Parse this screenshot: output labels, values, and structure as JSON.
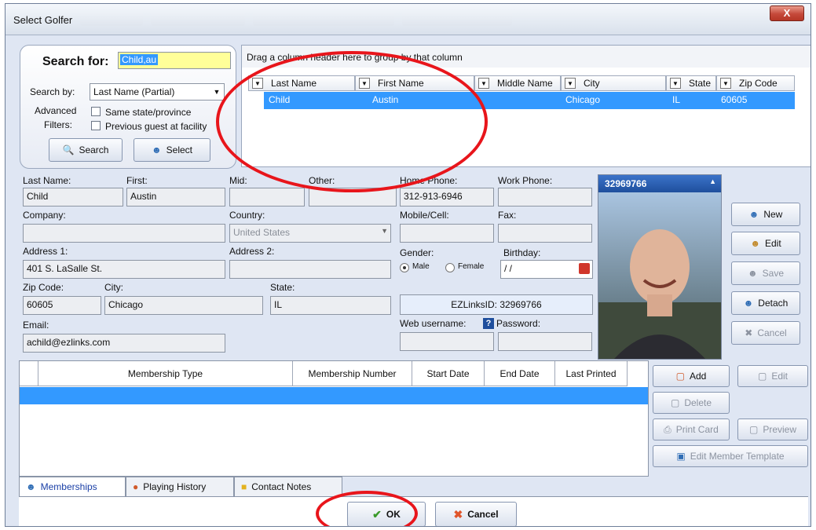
{
  "window": {
    "title": "Select Golfer",
    "close_label": "X"
  },
  "search": {
    "heading": "Search for:",
    "query": "Child,au",
    "search_by_label": "Search by:",
    "search_by_value": "Last Name (Partial)",
    "advanced_label": "Advanced",
    "filters_label": "Filters:",
    "same_state_label": "Same state/province",
    "previous_guest_label": "Previous guest at facility",
    "search_button": "Search",
    "select_button": "Select"
  },
  "grid": {
    "group_hint": "Drag a column header here to group by that column",
    "columns": [
      "Last Name",
      "First Name",
      "Middle Name",
      "City",
      "State",
      "Zip Code"
    ],
    "rows": [
      {
        "last": "Child",
        "first": "Austin",
        "middle": "",
        "city": "Chicago",
        "state": "IL",
        "zip": "60605"
      }
    ]
  },
  "form": {
    "last_name_label": "Last Name:",
    "last_name": "Child",
    "first_label": "First:",
    "first": "Austin",
    "mid_label": "Mid:",
    "mid": "",
    "other_label": "Other:",
    "other": "",
    "home_phone_label": "Home Phone:",
    "home_phone": "312-913-6946",
    "work_phone_label": "Work Phone:",
    "work_phone": "",
    "company_label": "Company:",
    "company": "",
    "country_label": "Country:",
    "country": "United States",
    "mobile_label": "Mobile/Cell:",
    "mobile": "",
    "fax_label": "Fax:",
    "fax": "",
    "address1_label": "Address 1:",
    "address1": "401 S. LaSalle St.",
    "address2_label": "Address 2:",
    "address2": "",
    "gender_label": "Gender:",
    "male_label": "Male",
    "female_label": "Female",
    "birthday_label": "Birthday:",
    "birthday": "/ /",
    "zip_label": "Zip Code:",
    "zip": "60605",
    "city_label": "City:",
    "city": "Chicago",
    "state_label": "State:",
    "state": "IL",
    "ezlinks_label": "EZLinksID:",
    "ezlinks_id": "32969766",
    "email_label": "Email:",
    "email": "achild@ezlinks.com",
    "web_username_label": "Web username:",
    "web_username": "",
    "password_label": "Password:",
    "password": "",
    "help_icon_text": "?"
  },
  "photo": {
    "id": "32969766"
  },
  "side_buttons": {
    "new": "New",
    "edit": "Edit",
    "save": "Save",
    "detach": "Detach",
    "cancel": "Cancel"
  },
  "membership": {
    "columns": [
      "Membership Type",
      "Membership Number",
      "Start Date",
      "End Date",
      "Last Printed"
    ],
    "buttons": {
      "add": "Add",
      "edit": "Edit",
      "delete": "Delete",
      "print_card": "Print Card",
      "preview": "Preview",
      "edit_template": "Edit Member Template"
    }
  },
  "tabs": [
    {
      "label": "Memberships",
      "active": true
    },
    {
      "label": "Playing History",
      "active": false
    },
    {
      "label": "Contact Notes",
      "active": false
    }
  ],
  "footer": {
    "ok": "OK",
    "cancel": "Cancel"
  },
  "colors": {
    "selection": "#3399ff",
    "annotation": "#e8151b",
    "title_blue": "#1f4f9d"
  }
}
